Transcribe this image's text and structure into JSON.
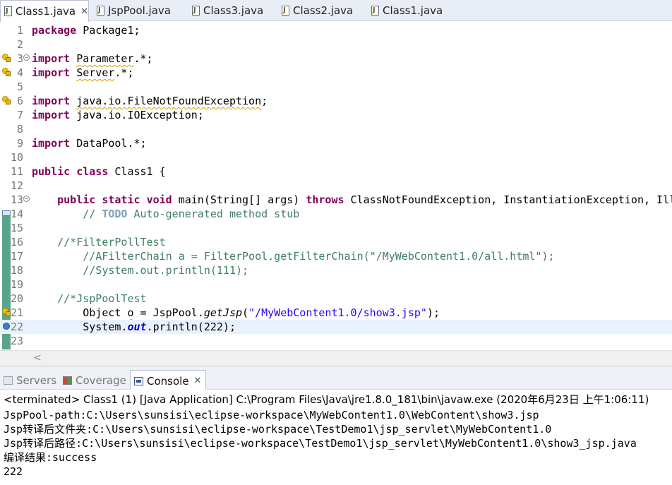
{
  "editor": {
    "tabs": [
      {
        "label": "Class1.java",
        "active": true,
        "closable": true
      },
      {
        "label": "JspPool.java"
      },
      {
        "label": "Class3.java"
      },
      {
        "label": "Class2.java"
      },
      {
        "label": "Class1.java"
      }
    ],
    "close_glyph": "✕",
    "line_numbers": [
      "1",
      "2",
      "3",
      "4",
      "5",
      "6",
      "7",
      "8",
      "9",
      "10",
      "11",
      "12",
      "13",
      "14",
      "15",
      "16",
      "17",
      "18",
      "19",
      "20",
      "21",
      "22",
      "23"
    ],
    "code": {
      "l1_kw": "package",
      "l1_rest": " Package1;",
      "l3_kw": "import",
      "l3_pre": " ",
      "l3_sq": "Parameter",
      "l3_rest": ".*;",
      "l4_kw": "import",
      "l4_pre": " ",
      "l4_sq": "Server",
      "l4_rest": ".*;",
      "l6_kw": "import",
      "l6_pre": " ",
      "l6_sq": "java.io.FileNotFoundException",
      "l6_rest": ";",
      "l7_kw": "import",
      "l7_rest": " java.io.IOException;",
      "l9_kw": "import",
      "l9_rest": " DataPool.*;",
      "l11_kw1": "public",
      "l11_sp": " ",
      "l11_kw2": "class",
      "l11_rest": " Class1 {",
      "l13_ind": "    ",
      "l13_kw1": "public",
      "l13_kw2": "static",
      "l13_kw3": "void",
      "l13_mid": " main(String[] args) ",
      "l13_kw4": "throws",
      "l13_rest": " ClassNotFoundException, InstantiationException, Ill",
      "l14_cm1": "        // ",
      "l14_todo": "TODO",
      "l14_cm2": " Auto-generated method stub",
      "l16_cm": "    //*FilterPollTest",
      "l17_cm": "        //AFilterChain a = FilterPool.getFilterChain(\"/MyWebContent1.0/all.html\");",
      "l18_cm": "        //System.out.println(111);",
      "l20_cm": "    //*JspPoolTest",
      "l21_a": "        Object ",
      "l21_var": "o",
      "l21_b": " = JspPool.",
      "l21_m": "getJsp",
      "l21_c": "(",
      "l21_str": "\"/MyWebContent1.0/show3.jsp\"",
      "l21_d": ");",
      "l22_a": "        System.",
      "l22_fld": "out",
      "l22_b": ".println(222);"
    },
    "scroll_left_glyph": "<",
    "current_line": 22
  },
  "views": {
    "tabs": [
      {
        "label": "Servers",
        "icon": "servers-icon"
      },
      {
        "label": "Coverage",
        "icon": "coverage-icon"
      },
      {
        "label": "Console",
        "icon": "console-icon",
        "active": true
      }
    ]
  },
  "console": {
    "status": "<terminated> Class1 (1) [Java Application] C:\\Program Files\\Java\\jre1.8.0_181\\bin\\javaw.exe (2020年6月23日 上午1:06:11)",
    "output": [
      "JspPool-path:C:\\Users\\sunsisi\\eclipse-workspace\\MyWebContent1.0\\WebContent\\show3.jsp",
      "Jsp转译后文件夹:C:\\Users\\sunsisi\\eclipse-workspace\\TestDemo1\\jsp_servlet\\MyWebContent1.0",
      "Jsp转译后路径:C:\\Users\\sunsisi\\eclipse-workspace\\TestDemo1\\jsp_servlet\\MyWebContent1.0\\show3_jsp.java",
      "编译结果:success",
      "222"
    ]
  },
  "colors": {
    "keyword": "#7f0055",
    "comment": "#3f7f5f",
    "string": "#2a00ff",
    "field": "#0000c0",
    "current_line": "#e8f2fe",
    "ruler": "#5aa48c"
  }
}
